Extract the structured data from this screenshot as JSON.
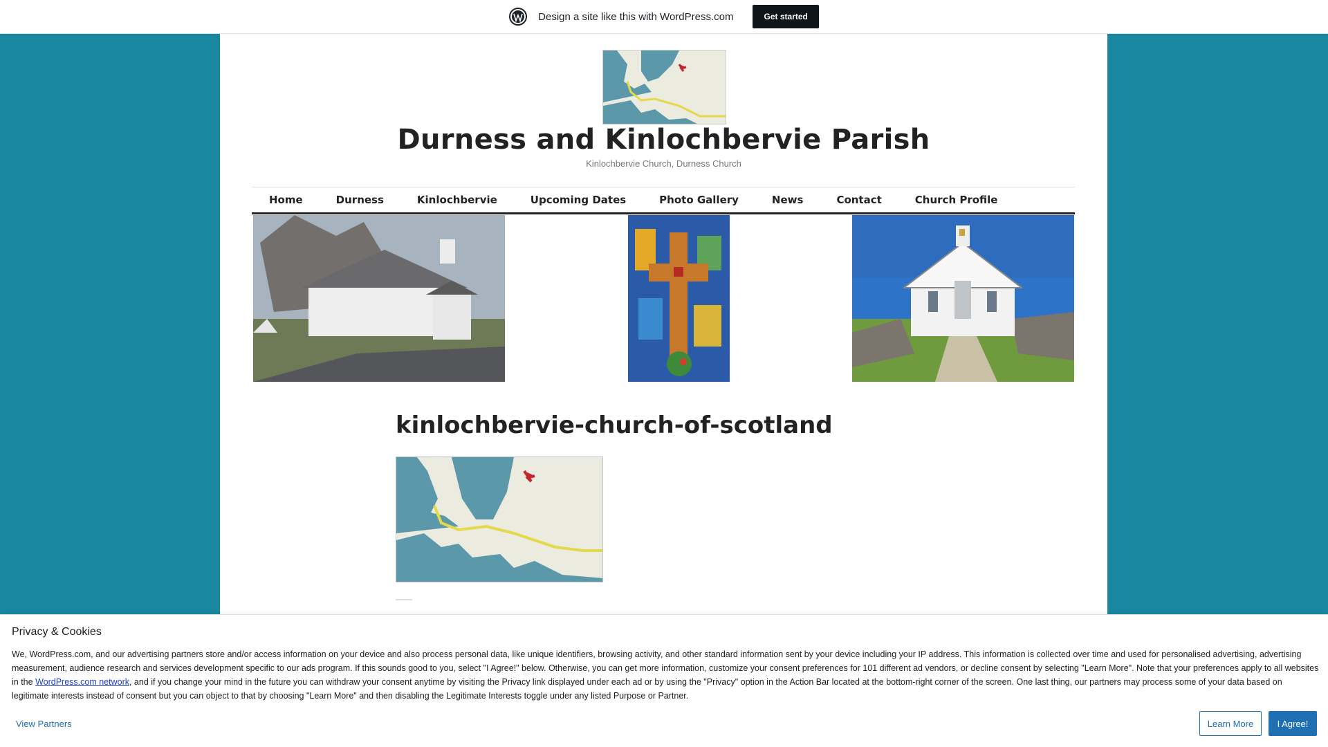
{
  "wpbar": {
    "text": "Design a site like this with WordPress.com",
    "cta": "Get started"
  },
  "site": {
    "title": "Durness and Kinlochbervie Parish",
    "description": "Kinlochbervie Church, Durness Church"
  },
  "nav": {
    "items": [
      "Home",
      "Durness",
      "Kinlochbervie",
      "Upcoming Dates",
      "Photo Gallery",
      "News",
      "Contact",
      "Church Profile"
    ]
  },
  "entry": {
    "title": "kinlochbervie-church-of-scotland"
  },
  "cookie": {
    "title": "Privacy & Cookies",
    "body_part1": "We, WordPress.com, and our advertising partners store and/or access information on your device and also process personal data, like unique identifiers, browsing activity, and other standard information sent by your device including your IP address. This information is collected over time and used for personalised advertising, advertising measurement, audience research and services development specific to our ads program. If this sounds good to you, select \"I Agree!\" below. Otherwise, you can get more information, customize your consent preferences for 101 different ad vendors, or decline consent by selecting \"Learn More\". Note that your preferences apply to all websites in the ",
    "link": "WordPress.com network",
    "body_part2": ", and if you change your mind in the future you can withdraw your consent anytime by visiting the Privacy link displayed under each ad or by using the \"Privacy\" option in the Action Bar located at the bottom-right corner of the screen. One last thing, our partners may process some of your data based on legitimate interests instead of consent but you can object to that by choosing \"Learn More\" and then disabling the Legitimate Interests toggle under any listed Purpose or Partner.",
    "view_partners": "View Partners",
    "learn_more": "Learn More",
    "agree": "I Agree!"
  },
  "colors": {
    "page_background": "#1a87a0",
    "cta_background": "#101517",
    "button_blue": "#1f6fb3"
  }
}
